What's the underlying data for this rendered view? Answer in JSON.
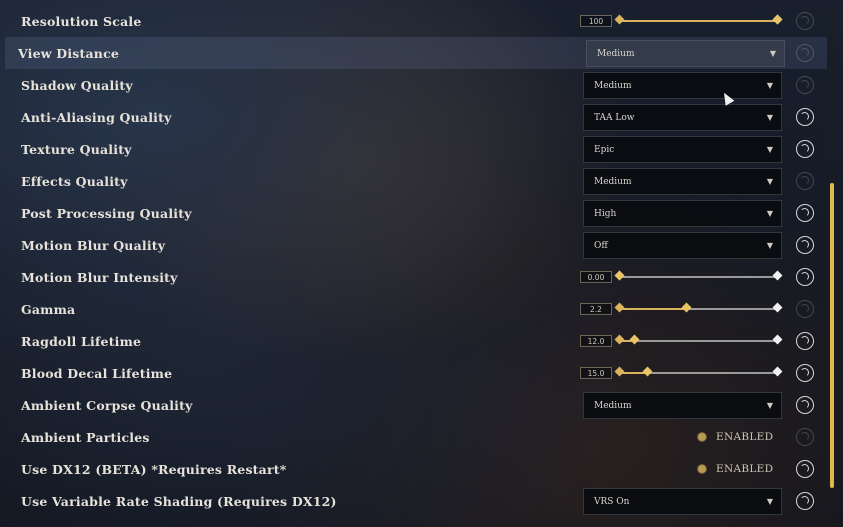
{
  "settings": [
    {
      "label": "Resolution Scale",
      "type": "slider",
      "value": "100",
      "fraction": 1.0,
      "reset_active": false
    },
    {
      "label": "View Distance",
      "type": "dropdown",
      "value": "Medium",
      "reset_active": false,
      "highlighted": true
    },
    {
      "label": "Shadow Quality",
      "type": "dropdown",
      "value": "Medium",
      "reset_active": false
    },
    {
      "label": "Anti-Aliasing Quality",
      "type": "dropdown",
      "value": "TAA Low",
      "reset_active": true
    },
    {
      "label": "Texture Quality",
      "type": "dropdown",
      "value": "Epic",
      "reset_active": true
    },
    {
      "label": "Effects Quality",
      "type": "dropdown",
      "value": "Medium",
      "reset_active": false
    },
    {
      "label": "Post Processing Quality",
      "type": "dropdown",
      "value": "High",
      "reset_active": true
    },
    {
      "label": "Motion Blur Quality",
      "type": "dropdown",
      "value": "Off",
      "reset_active": true
    },
    {
      "label": "Motion Blur Intensity",
      "type": "slider",
      "value": "0.00",
      "fraction": 0.0,
      "reset_active": true
    },
    {
      "label": "Gamma",
      "type": "slider",
      "value": "2.2",
      "fraction": 0.43,
      "reset_active": false
    },
    {
      "label": "Ragdoll Lifetime",
      "type": "slider",
      "value": "12.0",
      "fraction": 0.1,
      "reset_active": true
    },
    {
      "label": "Blood Decal Lifetime",
      "type": "slider",
      "value": "15.0",
      "fraction": 0.18,
      "reset_active": true
    },
    {
      "label": "Ambient Corpse Quality",
      "type": "dropdown",
      "value": "Medium",
      "reset_active": true
    },
    {
      "label": "Ambient Particles",
      "type": "toggle",
      "value": "ENABLED",
      "reset_active": false
    },
    {
      "label": "Use DX12 (BETA) *Requires Restart*",
      "type": "toggle",
      "value": "ENABLED",
      "reset_active": true
    },
    {
      "label": "Use Variable Rate Shading (Requires DX12)",
      "type": "dropdown",
      "value": "VRS On",
      "reset_active": true
    }
  ],
  "icons": {
    "reset": "reset-icon",
    "dropdown": "chevron-down-icon"
  },
  "colors": {
    "accent": "#e0b84c",
    "text": "#e7e3da"
  }
}
